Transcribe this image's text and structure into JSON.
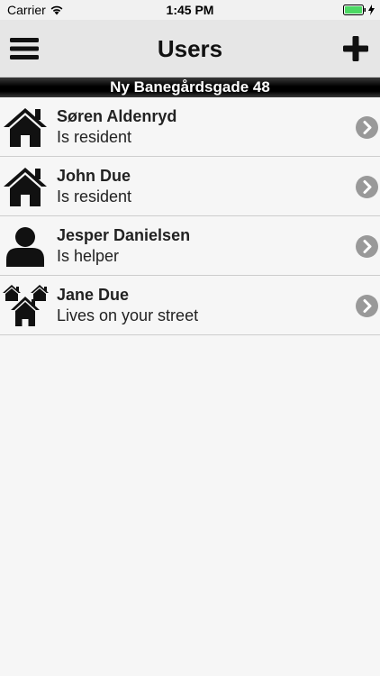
{
  "status_bar": {
    "carrier": "Carrier",
    "time": "1:45 PM"
  },
  "nav": {
    "title": "Users",
    "menu_icon": "hamburger-icon",
    "add_icon": "plus-icon"
  },
  "address": "Ny Banegårdsgade 48",
  "users": [
    {
      "name": "Søren Aldenryd",
      "status": "Is resident",
      "icon": "house-icon"
    },
    {
      "name": "John Due",
      "status": "Is resident",
      "icon": "house-icon"
    },
    {
      "name": "Jesper Danielsen",
      "status": "Is helper",
      "icon": "person-icon"
    },
    {
      "name": "Jane Due",
      "status": "Lives on your street",
      "icon": "street-houses-icon"
    }
  ],
  "colors": {
    "battery": "#4cd964",
    "chevron": "#999999",
    "address_bg": "#000000"
  }
}
